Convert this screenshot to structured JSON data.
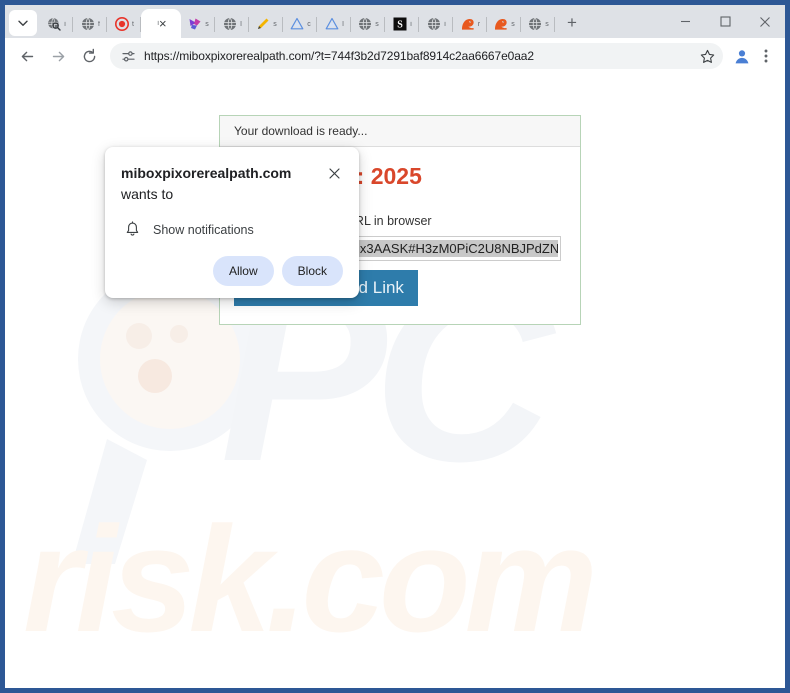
{
  "browser": {
    "tab_search_icon": "chevron-down-icon",
    "tabs": [
      {
        "favicon": "globe-magnifier-icon",
        "title": "i",
        "active": false
      },
      {
        "favicon": "globe-icon",
        "title": "f",
        "active": false
      },
      {
        "favicon": "red-circle-icon",
        "title": "t",
        "active": false
      },
      {
        "favicon": "blank-icon",
        "title": "i",
        "active": true,
        "close_label": "×"
      },
      {
        "favicon": "purple-bird-icon",
        "title": "s",
        "active": false
      },
      {
        "favicon": "globe-icon",
        "title": "l",
        "active": false
      },
      {
        "favicon": "yellow-pen-icon",
        "title": "s",
        "active": false
      },
      {
        "favicon": "blue-cloud-icon",
        "title": "c",
        "active": false
      },
      {
        "favicon": "blue-cloud-icon",
        "title": "l",
        "active": false
      },
      {
        "favicon": "globe-icon",
        "title": "s",
        "active": false
      },
      {
        "favicon": "black-s-icon",
        "title": "i",
        "active": false
      },
      {
        "favicon": "globe-icon",
        "title": "i",
        "active": false
      },
      {
        "favicon": "orange-dragon-icon",
        "title": "r",
        "active": false
      },
      {
        "favicon": "orange-dragon-icon",
        "title": "s",
        "active": false
      },
      {
        "favicon": "globe-icon",
        "title": "s",
        "active": false
      }
    ],
    "new_tab_label": "+",
    "window_controls": {
      "minimize": "minimize-icon",
      "maximize": "maximize-icon",
      "close": "close-icon"
    },
    "toolbar": {
      "back_icon": "arrow-left-icon",
      "forward_icon": "arrow-right-icon",
      "reload_icon": "reload-icon",
      "site_info_icon": "tune-settings-icon",
      "url": "https://miboxpixorerealpath.com/?t=744f3b2d7291baf8914c2aa6667e0aa2",
      "bookmark_icon": "star-icon",
      "profile_icon": "profile-avatar-icon",
      "menu_icon": "three-dot-menu-icon"
    }
  },
  "permission_popup": {
    "origin": "miboxpixorerealpath.com",
    "title_suffix": " wants to",
    "close_label": "✕",
    "permission_icon": "bell-icon",
    "permission_label": "Show notifications",
    "allow_label": "Allow",
    "block_label": "Block",
    "button_bg": "#d9e4fb"
  },
  "page": {
    "card": {
      "status_text": "Your download is ready...",
      "headline": "Downloads: 2025",
      "instruction": "Copy and paste the URL in browser",
      "url_value": "https://mega.nz/file/3ix3AASK#H3zM0PiC2U8NBJPdZN",
      "copy_button_label": "Copy Download Link",
      "border_color": "#b7d4b7",
      "headline_color": "#d9472b",
      "button_color": "#2e7cab"
    },
    "watermark": {
      "line1": "PC",
      "line2": "risk.com",
      "icon": "magnifier-icon"
    }
  }
}
